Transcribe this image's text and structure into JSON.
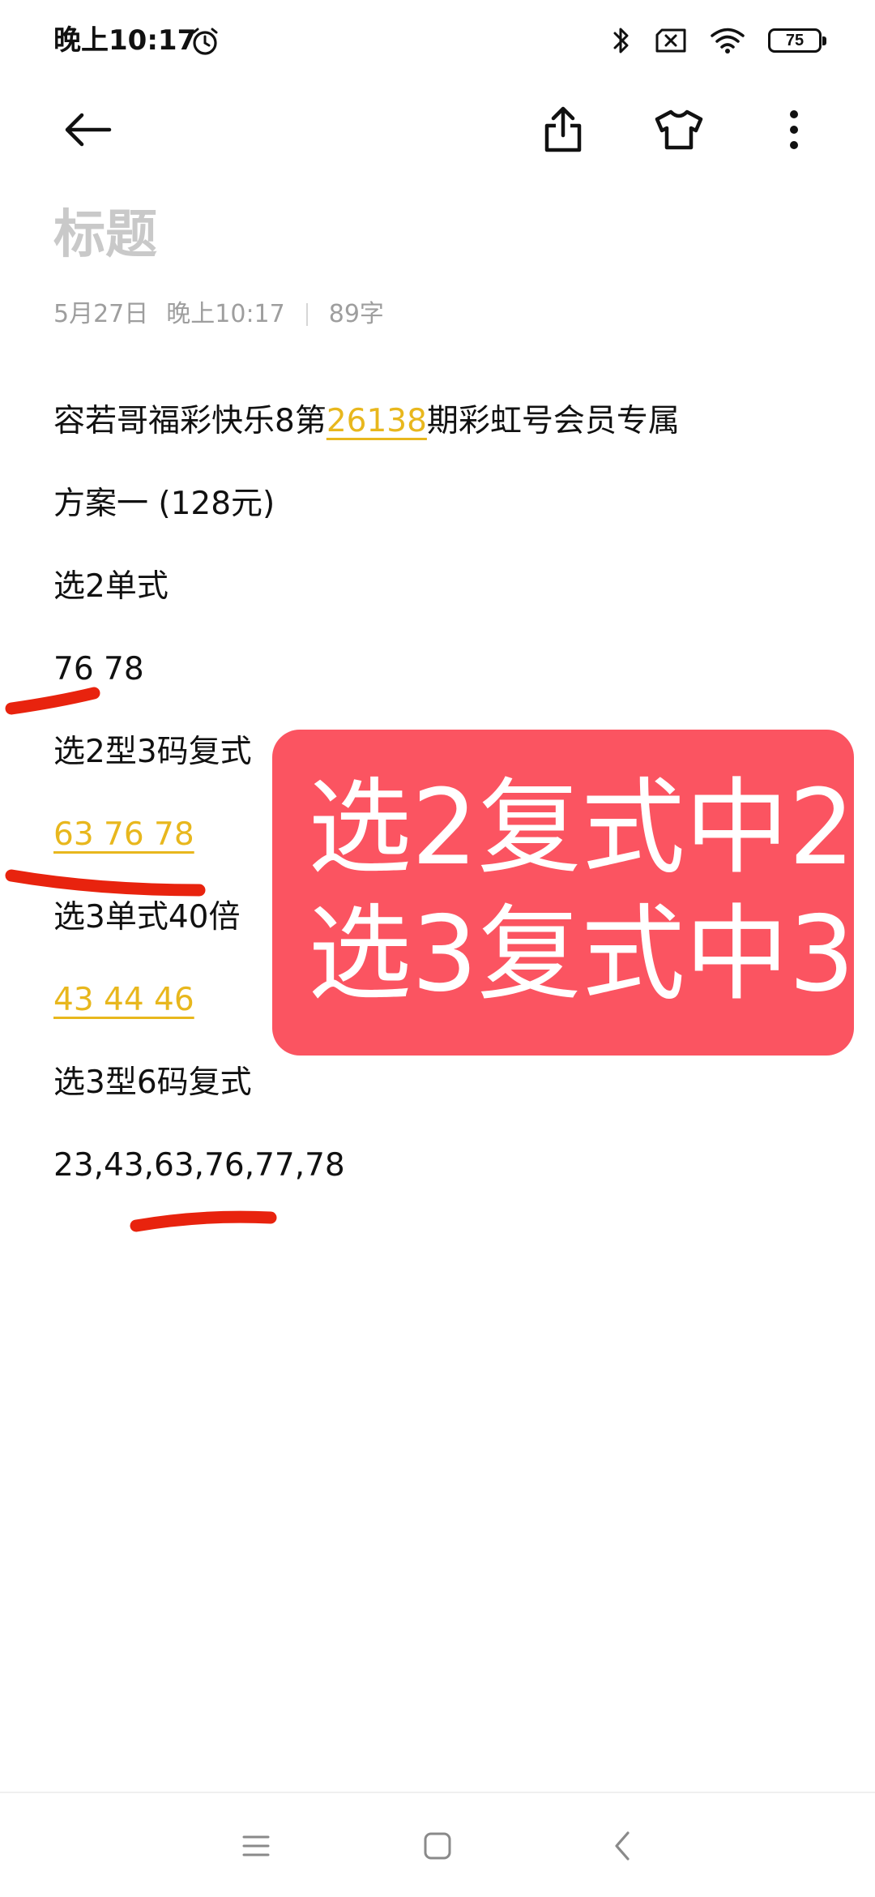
{
  "status_bar": {
    "time": "晚上10:17",
    "battery_level": "75",
    "icons": [
      "alarm-icon",
      "bluetooth-icon",
      "sim-no-signal-icon",
      "wifi-icon",
      "battery-icon"
    ]
  },
  "toolbar": {
    "icons": [
      "back-arrow-icon",
      "share-icon",
      "tshirt-theme-icon",
      "more-vertical-icon"
    ]
  },
  "note": {
    "title_placeholder": "标题",
    "meta": {
      "date": "5月27日",
      "time": "晚上10:17",
      "char_count": "89字"
    },
    "lines": {
      "l1_prefix": "容若哥福彩快乐8第",
      "l1_issue": "26138",
      "l1_suffix": "期彩虹号会员专属",
      "l2": "方案一 (128元)",
      "l3": "选2单式",
      "l4": "76 78",
      "l5": "选2型3码复式",
      "l6": "63 76 78",
      "l7": "选3单式40倍",
      "l8": "43 44 46",
      "l9": "选3型6码复式",
      "l10": "23,43,63,76,77,78"
    }
  },
  "sticker": {
    "line1": "选2复式中2",
    "line2": "选3复式中3",
    "color": "#fb5461"
  },
  "colors": {
    "highlight": "#e8b71d",
    "marker": "#e8230e",
    "title_placeholder": "#c9c9c9",
    "meta": "#9e9e9e"
  },
  "nav_bar": {
    "icons": [
      "menu-icon",
      "home-square-icon",
      "back-chevron-icon"
    ]
  }
}
